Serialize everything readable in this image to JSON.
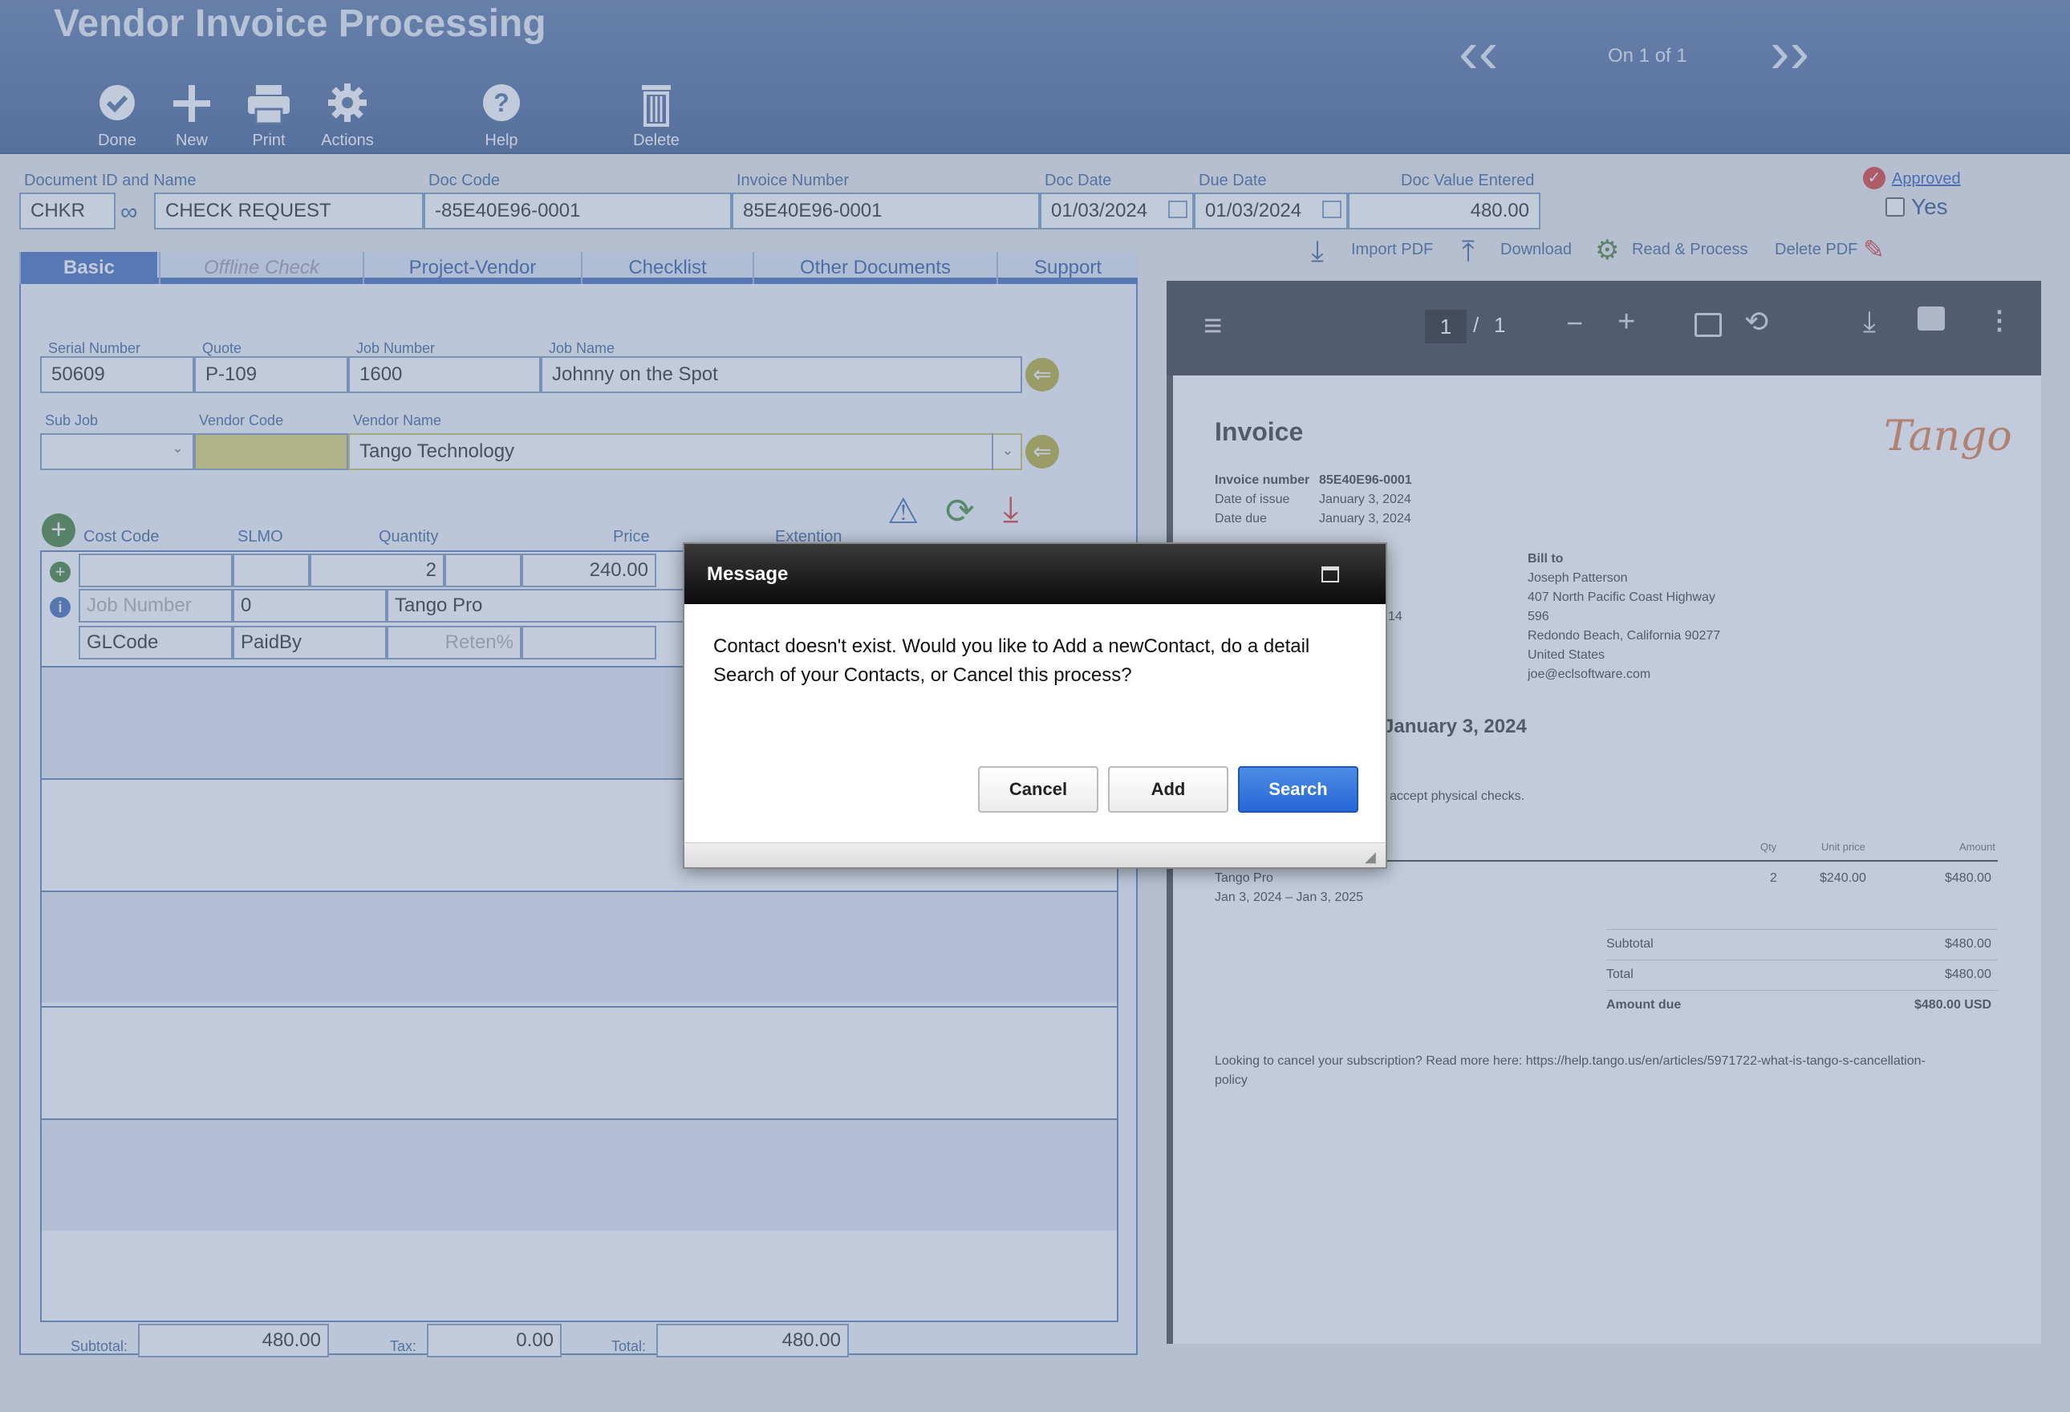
{
  "app": {
    "title": "Vendor Invoice Processing",
    "record_position": "On 1 of 1"
  },
  "toolbar": {
    "done": "Done",
    "new": "New",
    "print": "Print",
    "actions": "Actions",
    "help": "Help",
    "delete": "Delete"
  },
  "header_fields": {
    "doc_id_label": "Document ID and Name",
    "doc_id": "CHKR",
    "doc_name": "CHECK REQUEST",
    "doc_code_label": "Doc Code",
    "doc_code": "-85E40E96-0001",
    "invoice_number_label": "Invoice Number",
    "invoice_number": "85E40E96-0001",
    "doc_date_label": "Doc Date",
    "doc_date": "01/03/2024",
    "due_date_label": "Due Date",
    "due_date": "01/03/2024",
    "doc_value_label": "Doc Value Entered",
    "doc_value": "480.00",
    "approved_label": "Approved",
    "approved_value": "Yes"
  },
  "pdf_actions": {
    "import": "Import PDF",
    "download": "Download",
    "read_process": "Read & Process",
    "delete": "Delete PDF"
  },
  "tabs": [
    {
      "label": "Basic"
    },
    {
      "label": "Offline Check"
    },
    {
      "label": "Project-Vendor"
    },
    {
      "label": "Checklist"
    },
    {
      "label": "Other Documents"
    },
    {
      "label": "Support"
    }
  ],
  "basic": {
    "serial_label": "Serial Number",
    "serial": "50609",
    "quote_label": "Quote",
    "quote": "P-109",
    "job_number_label": "Job Number",
    "job_number": "1600",
    "job_name_label": "Job Name",
    "job_name": "Johnny on the Spot",
    "sub_job_label": "Sub Job",
    "sub_job": "",
    "vendor_code_label": "Vendor Code",
    "vendor_code": "",
    "vendor_name_label": "Vendor Name",
    "vendor_name": "Tango Technology"
  },
  "lines": {
    "col_cost_code": "Cost Code",
    "col_slmo": "SLMO",
    "col_quantity": "Quantity",
    "col_price": "Price",
    "col_extention": "Extention",
    "row1": {
      "quantity": "2",
      "price": "240.00",
      "job_number_ph": "Job Number",
      "slmo_value": "0",
      "description": "Tango Pro",
      "glcode": "GLCode",
      "paidby": "PaidBy",
      "reten_ph": "Reten%"
    }
  },
  "totals": {
    "subtotal_label": "Subtotal:",
    "subtotal": "480.00",
    "tax_label": "Tax:",
    "tax": "0.00",
    "total_label": "Total:",
    "total": "480.00"
  },
  "pdf_viewer": {
    "page": "1",
    "sep": "/",
    "pages": "1"
  },
  "invoice": {
    "heading": "Invoice",
    "logo_text": "Tango",
    "number_label": "Invoice number",
    "number": "85E40E96-0001",
    "issue_label": "Date of issue",
    "issue": "January 3, 2024",
    "due_label": "Date due",
    "due": "January 3, 2024",
    "bill_to_label": "Bill to",
    "bill_to": [
      "Joseph Patterson",
      "407 North Pacific Coast Highway",
      "596",
      "Redondo Beach, California 90277",
      "United States",
      "joe@eclsoftware.com"
    ],
    "partial_14": "14",
    "partial_due_heading": "January 3, 2024",
    "partial_checks": "accept physical checks.",
    "col_qty": "Qty",
    "col_unit": "Unit price",
    "col_amount": "Amount",
    "item_name": "Tango Pro",
    "item_period": "Jan 3, 2024 – Jan 3, 2025",
    "item_qty": "2",
    "item_unit": "$240.00",
    "item_amount": "$480.00",
    "subtotal_label": "Subtotal",
    "subtotal": "$480.00",
    "total_label": "Total",
    "total": "$480.00",
    "amount_due_label": "Amount due",
    "amount_due": "$480.00 USD",
    "footer": "Looking to cancel your subscription? Read more here: https://help.tango.us/en/articles/5971722-what-is-tango-s-cancellation-",
    "footer2": "policy"
  },
  "dialog": {
    "title": "Message",
    "message": "Contact doesn't exist. Would you like to Add a newContact, do a detail Search of your Contacts, or Cancel this process?",
    "cancel": "Cancel",
    "add": "Add",
    "search": "Search"
  },
  "colors": {
    "header": "#4a6a9c",
    "accent": "#3d69b8",
    "primary_button": "#2e72de",
    "vendor_code_highlight": "#c9c25a"
  }
}
